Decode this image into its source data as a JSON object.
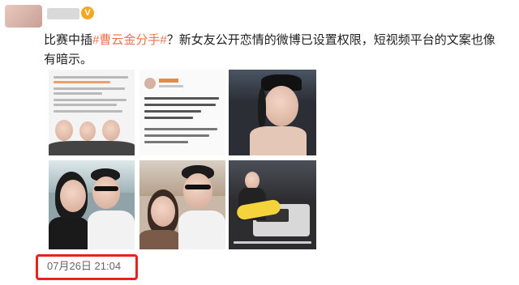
{
  "post": {
    "text_before": "比赛中插",
    "hashtag": "#曹云金分手#",
    "text_after": "？新女友公开恋情的微博已设置权限，短视频平台的文案也像有暗示。",
    "timestamp": "07月26日 21:04",
    "verified_badge": "V"
  },
  "colors": {
    "hashtag": "#eb7350",
    "highlight_box": "#e8231a",
    "verified": "#f5a623"
  },
  "images": [
    {
      "icon": "screenshot-weibo-comments"
    },
    {
      "icon": "screenshot-weibo-profile-post"
    },
    {
      "icon": "photo-woman-cap-selfie"
    },
    {
      "icon": "photo-couple-selfie-outdoor"
    },
    {
      "icon": "photo-couple-selfie-sunglasses"
    },
    {
      "icon": "photo-video-still-car"
    }
  ]
}
